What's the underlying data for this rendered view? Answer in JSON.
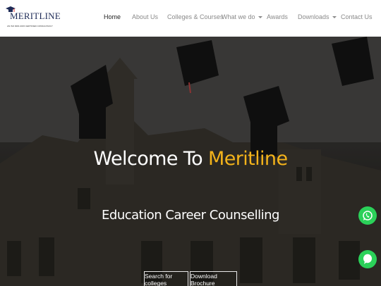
{
  "brand": {
    "name": "MERITLINE",
    "tagline": "AN ISO 9001:2015 CERTIFIED CONSULTANCY"
  },
  "nav": {
    "items": [
      {
        "label": "Home",
        "active": true
      },
      {
        "label": "About Us"
      },
      {
        "label": "Colleges & Courses"
      },
      {
        "label": "What we do",
        "dropdown": true
      },
      {
        "label": "Awards"
      },
      {
        "label": "Downloads",
        "dropdown": true
      },
      {
        "label": "Contact Us"
      }
    ]
  },
  "hero": {
    "title_prefix": "Welcome To ",
    "title_brand": "Meritline",
    "subtitle": "Education Career Counselling",
    "buttons": {
      "search": "Search for colleges",
      "brochure": "Download Brochure"
    }
  },
  "colors": {
    "accent": "#f3b31b",
    "whatsapp": "#2bd159",
    "nav_active": "#222222",
    "nav_text": "#8a8a8a"
  },
  "icons": [
    "graduation-cap-icon",
    "whatsapp-icon",
    "chat-bubble-icon"
  ]
}
